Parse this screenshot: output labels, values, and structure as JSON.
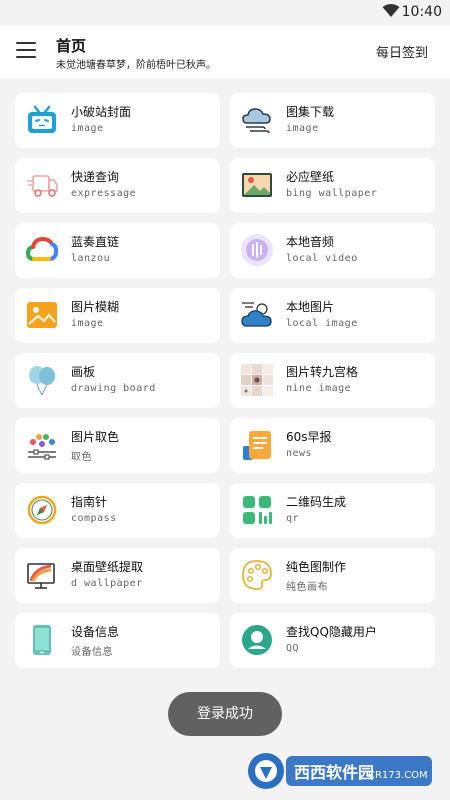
{
  "status": {
    "time": "10:40"
  },
  "header": {
    "title": "首页",
    "subtitle": "未觉池塘春草梦，阶前梧叶已秋声。",
    "checkin": "每日签到"
  },
  "cards": [
    {
      "title": "小破站封面",
      "sub": "image",
      "icon": "bilibili-tv-icon"
    },
    {
      "title": "图集下载",
      "sub": "image",
      "icon": "cloud-wind-icon"
    },
    {
      "title": "快递查询",
      "sub": "expressage",
      "icon": "delivery-truck-icon"
    },
    {
      "title": "必应壁纸",
      "sub": "bing wallpaper",
      "icon": "landscape-picture-icon"
    },
    {
      "title": "蓝奏直链",
      "sub": "lanzou",
      "icon": "google-cloud-icon"
    },
    {
      "title": "本地音频",
      "sub": "local video",
      "icon": "audio-wave-icon"
    },
    {
      "title": "图片模糊",
      "sub": "image",
      "icon": "orange-image-icon"
    },
    {
      "title": "本地图片",
      "sub": "local image",
      "icon": "sun-cloud-icon"
    },
    {
      "title": "画板",
      "sub": "drawing board",
      "icon": "balloons-icon"
    },
    {
      "title": "图片转九宫格",
      "sub": "nine image",
      "icon": "nine-grid-icon"
    },
    {
      "title": "图片取色",
      "sub": "取色",
      "icon": "color-picker-icon"
    },
    {
      "title": "60s早报",
      "sub": "news",
      "icon": "newspaper-icon"
    },
    {
      "title": "指南针",
      "sub": "compass",
      "icon": "compass-icon"
    },
    {
      "title": "二维码生成",
      "sub": "qr",
      "icon": "qr-code-icon"
    },
    {
      "title": "桌面壁纸提取",
      "sub": "d wallpaper",
      "icon": "desktop-wallpaper-icon"
    },
    {
      "title": "纯色图制作",
      "sub": "纯色画布",
      "icon": "palette-icon"
    },
    {
      "title": "设备信息",
      "sub": "设备信息",
      "icon": "phone-device-icon"
    },
    {
      "title": "查找QQ隐藏用户",
      "sub": "QQ",
      "icon": "qq-user-icon"
    }
  ],
  "toast": "登录成功",
  "watermark": {
    "logo_text": "西西软件园",
    "domain_text": "CR173.COM"
  }
}
